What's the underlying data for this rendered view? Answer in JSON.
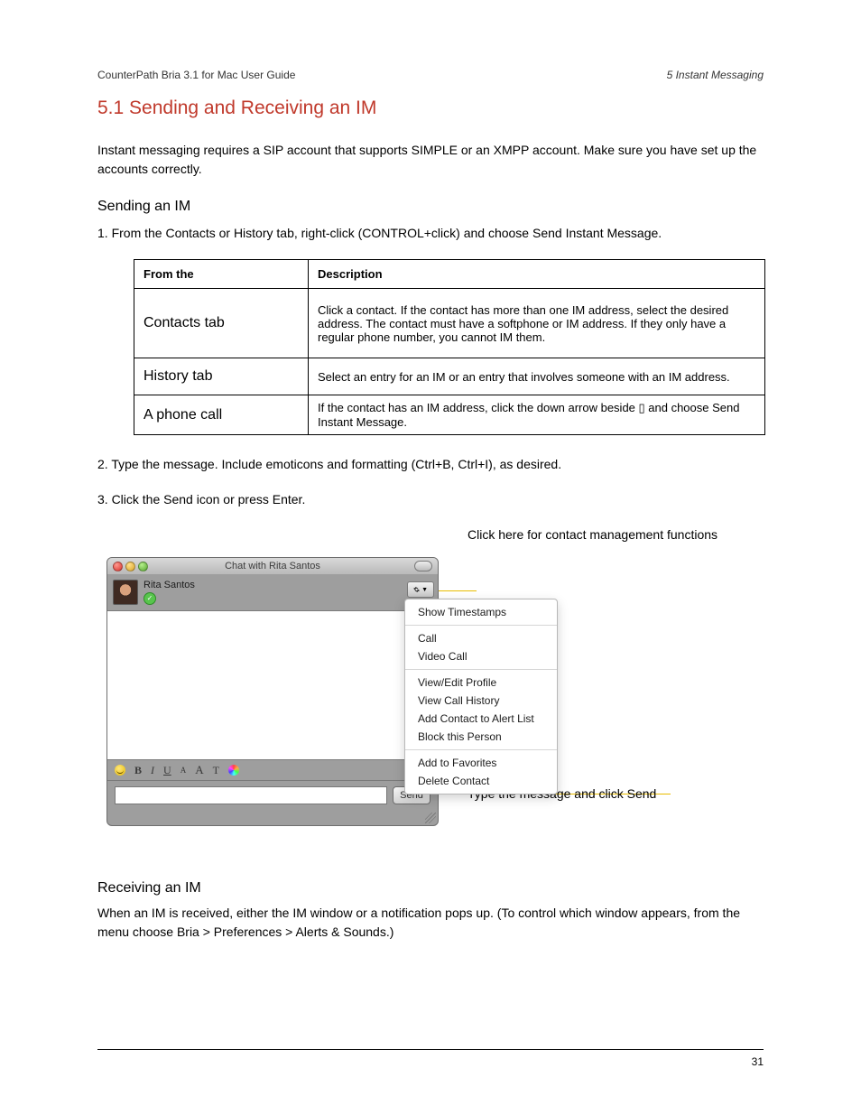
{
  "header": {
    "left": "CounterPath Bria 3.1 for Mac User Guide",
    "right": "5 Instant Messaging"
  },
  "heading": "5.1 Sending and Receiving an IM",
  "intro": "Instant messaging requires a SIP account that supports SIMPLE or an XMPP account. Make sure you have set up the accounts correctly.",
  "section_title": "Sending an IM",
  "send_step": "1. From the Contacts or History tab, right-click (CONTROL+click) and choose Send Instant Message.",
  "table": {
    "headers": [
      "From the",
      "Description"
    ],
    "rows": [
      {
        "c1": "Contacts tab",
        "c2": "Click a contact. If the contact has more than one IM address, select the desired address. The contact must have a softphone or IM address. If they only have a regular phone number, you cannot IM them."
      },
      {
        "c1": "History tab",
        "c2": "Select an entry for an IM or an entry that involves someone with an IM address."
      },
      {
        "c1": "A phone call",
        "c2": "If the contact has an IM address, click the down arrow beside ▯ and choose Send Instant Message."
      }
    ]
  },
  "step2": "2. Type the message. Include emoticons and formatting (Ctrl+B, Ctrl+I), as desired.",
  "step3": "3. Click the Send icon or press Enter.",
  "callouts": {
    "c1": "Click here for contact management functions",
    "c2": "Type the message and click Send"
  },
  "chat": {
    "title": "Chat with Rita Santos",
    "contact_name": "Rita Santos",
    "presence": "✓",
    "gear_label": "⚙ ▾",
    "format": {
      "bold": "B",
      "italic": "I",
      "underline": "U",
      "size_small": "A",
      "size_big": "A",
      "font": "T"
    },
    "send_label": "Send",
    "input_value": ""
  },
  "menu": {
    "show_timestamps": "Show Timestamps",
    "call": "Call",
    "video_call": "Video Call",
    "view_edit_profile": "View/Edit Profile",
    "view_call_history": "View Call History",
    "add_alert": "Add Contact to Alert List",
    "block": "Block this Person",
    "add_fav": "Add to Favorites",
    "delete": "Delete Contact"
  },
  "receive_title": "Receiving an IM",
  "receive_body": "When an IM is received, either the IM window or a notification pops up. (To control which window appears, from the menu choose Bria > Preferences > Alerts & Sounds.)",
  "footer": {
    "page": "31"
  }
}
